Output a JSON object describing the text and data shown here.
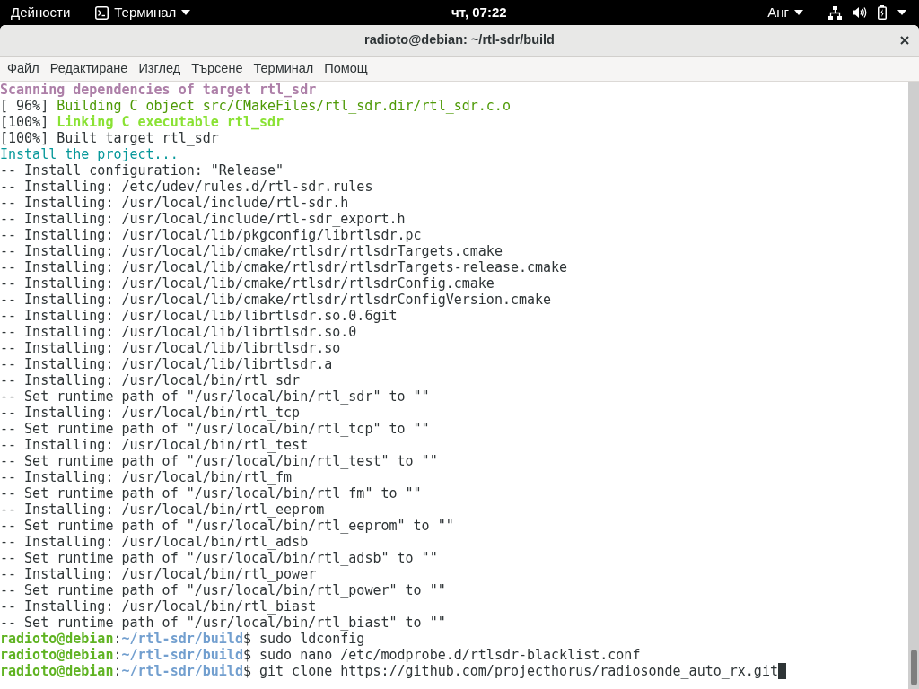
{
  "top_bar": {
    "activities": "Дейности",
    "app_menu": "Терминал",
    "clock": "чт, 07:22",
    "keyboard_layout": "Анг"
  },
  "window": {
    "title": "radioto@debian: ~/rtl-sdr/build"
  },
  "menu": [
    "Файл",
    "Редактиране",
    "Изглед",
    "Търсене",
    "Терминал",
    "Помощ"
  ],
  "terminal": {
    "cursor": true,
    "lines": [
      {
        "kind": "scan",
        "text": "Scanning dependencies of target rtl_sdr"
      },
      {
        "kind": "build",
        "progress": "[ 96%]",
        "text": "Building C object src/CMakeFiles/rtl_sdr.dir/rtl_sdr.c.o"
      },
      {
        "kind": "link",
        "progress": "[100%]",
        "text": "Linking C executable rtl_sdr"
      },
      {
        "kind": "output",
        "text": "[100%] Built target rtl_sdr"
      },
      {
        "kind": "install",
        "text": "Install the project..."
      },
      {
        "kind": "output",
        "text": "-- Install configuration: \"Release\""
      },
      {
        "kind": "output",
        "text": "-- Installing: /etc/udev/rules.d/rtl-sdr.rules"
      },
      {
        "kind": "output",
        "text": "-- Installing: /usr/local/include/rtl-sdr.h"
      },
      {
        "kind": "output",
        "text": "-- Installing: /usr/local/include/rtl-sdr_export.h"
      },
      {
        "kind": "output",
        "text": "-- Installing: /usr/local/lib/pkgconfig/librtlsdr.pc"
      },
      {
        "kind": "output",
        "text": "-- Installing: /usr/local/lib/cmake/rtlsdr/rtlsdrTargets.cmake"
      },
      {
        "kind": "output",
        "text": "-- Installing: /usr/local/lib/cmake/rtlsdr/rtlsdrTargets-release.cmake"
      },
      {
        "kind": "output",
        "text": "-- Installing: /usr/local/lib/cmake/rtlsdr/rtlsdrConfig.cmake"
      },
      {
        "kind": "output",
        "text": "-- Installing: /usr/local/lib/cmake/rtlsdr/rtlsdrConfigVersion.cmake"
      },
      {
        "kind": "output",
        "text": "-- Installing: /usr/local/lib/librtlsdr.so.0.6git"
      },
      {
        "kind": "output",
        "text": "-- Installing: /usr/local/lib/librtlsdr.so.0"
      },
      {
        "kind": "output",
        "text": "-- Installing: /usr/local/lib/librtlsdr.so"
      },
      {
        "kind": "output",
        "text": "-- Installing: /usr/local/lib/librtlsdr.a"
      },
      {
        "kind": "output",
        "text": "-- Installing: /usr/local/bin/rtl_sdr"
      },
      {
        "kind": "output",
        "text": "-- Set runtime path of \"/usr/local/bin/rtl_sdr\" to \"\""
      },
      {
        "kind": "output",
        "text": "-- Installing: /usr/local/bin/rtl_tcp"
      },
      {
        "kind": "output",
        "text": "-- Set runtime path of \"/usr/local/bin/rtl_tcp\" to \"\""
      },
      {
        "kind": "output",
        "text": "-- Installing: /usr/local/bin/rtl_test"
      },
      {
        "kind": "output",
        "text": "-- Set runtime path of \"/usr/local/bin/rtl_test\" to \"\""
      },
      {
        "kind": "output",
        "text": "-- Installing: /usr/local/bin/rtl_fm"
      },
      {
        "kind": "output",
        "text": "-- Set runtime path of \"/usr/local/bin/rtl_fm\" to \"\""
      },
      {
        "kind": "output",
        "text": "-- Installing: /usr/local/bin/rtl_eeprom"
      },
      {
        "kind": "output",
        "text": "-- Set runtime path of \"/usr/local/bin/rtl_eeprom\" to \"\""
      },
      {
        "kind": "output",
        "text": "-- Installing: /usr/local/bin/rtl_adsb"
      },
      {
        "kind": "output",
        "text": "-- Set runtime path of \"/usr/local/bin/rtl_adsb\" to \"\""
      },
      {
        "kind": "output",
        "text": "-- Installing: /usr/local/bin/rtl_power"
      },
      {
        "kind": "output",
        "text": "-- Set runtime path of \"/usr/local/bin/rtl_power\" to \"\""
      },
      {
        "kind": "output",
        "text": "-- Installing: /usr/local/bin/rtl_biast"
      },
      {
        "kind": "output",
        "text": "-- Set runtime path of \"/usr/local/bin/rtl_biast\" to \"\""
      },
      {
        "kind": "prompt",
        "user": "radioto@debian",
        "separator": ":",
        "path": "~/rtl-sdr/build",
        "sigil": "$",
        "command": "sudo ldconfig"
      },
      {
        "kind": "prompt",
        "user": "radioto@debian",
        "separator": ":",
        "path": "~/rtl-sdr/build",
        "sigil": "$",
        "command": "sudo nano /etc/modprobe.d/rtlsdr-blacklist.conf"
      },
      {
        "kind": "prompt",
        "user": "radioto@debian",
        "separator": ":",
        "path": "~/rtl-sdr/build",
        "sigil": "$",
        "command": "git clone https://github.com/projecthorus/radiosonde_auto_rx.git"
      }
    ]
  }
}
